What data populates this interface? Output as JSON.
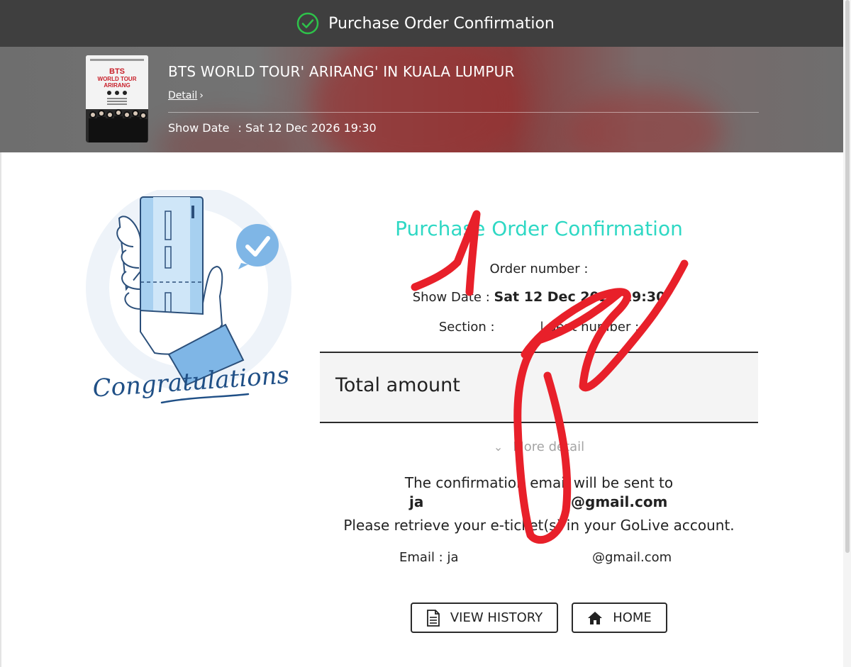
{
  "header": {
    "title": "Purchase Order Confirmation"
  },
  "event": {
    "title": "BTS WORLD TOUR' ARIRANG' IN KUALA LUMPUR",
    "detail_link": "Detail",
    "show_date_label": "Show Date",
    "show_date_value": ": Sat 12 Dec 2026 19:30",
    "poster": {
      "line1": "BTS",
      "line2": "WORLD TOUR",
      "line3": "ARIRANG"
    }
  },
  "illustration": {
    "caption": "Congratulations"
  },
  "confirmation": {
    "title": "Purchase Order Confirmation",
    "order_number_label": "Order number :",
    "show_date_label": "Show Date :",
    "show_date_value": "Sat 12 Dec 2026 19:30",
    "section_label": "Section :",
    "seat_label": "| Seat number :",
    "total_label": "Total amount",
    "more_detail": "More detail",
    "email_notice": "The confirmation email will be sent to",
    "email_part1": "ja",
    "email_part2": "@gmail.com",
    "retrieve_notice": "Please retrieve your e-ticket(s) in your GoLive account.",
    "email_label": "Email : ja",
    "email_domain": "@gmail.com"
  },
  "buttons": {
    "history": "VIEW HISTORY",
    "home": "HOME"
  },
  "colors": {
    "accent_teal": "#2fd8c4",
    "header_bg": "#3f3f3f",
    "scribble_red": "#e8202a",
    "check_green": "#2ec24a"
  }
}
